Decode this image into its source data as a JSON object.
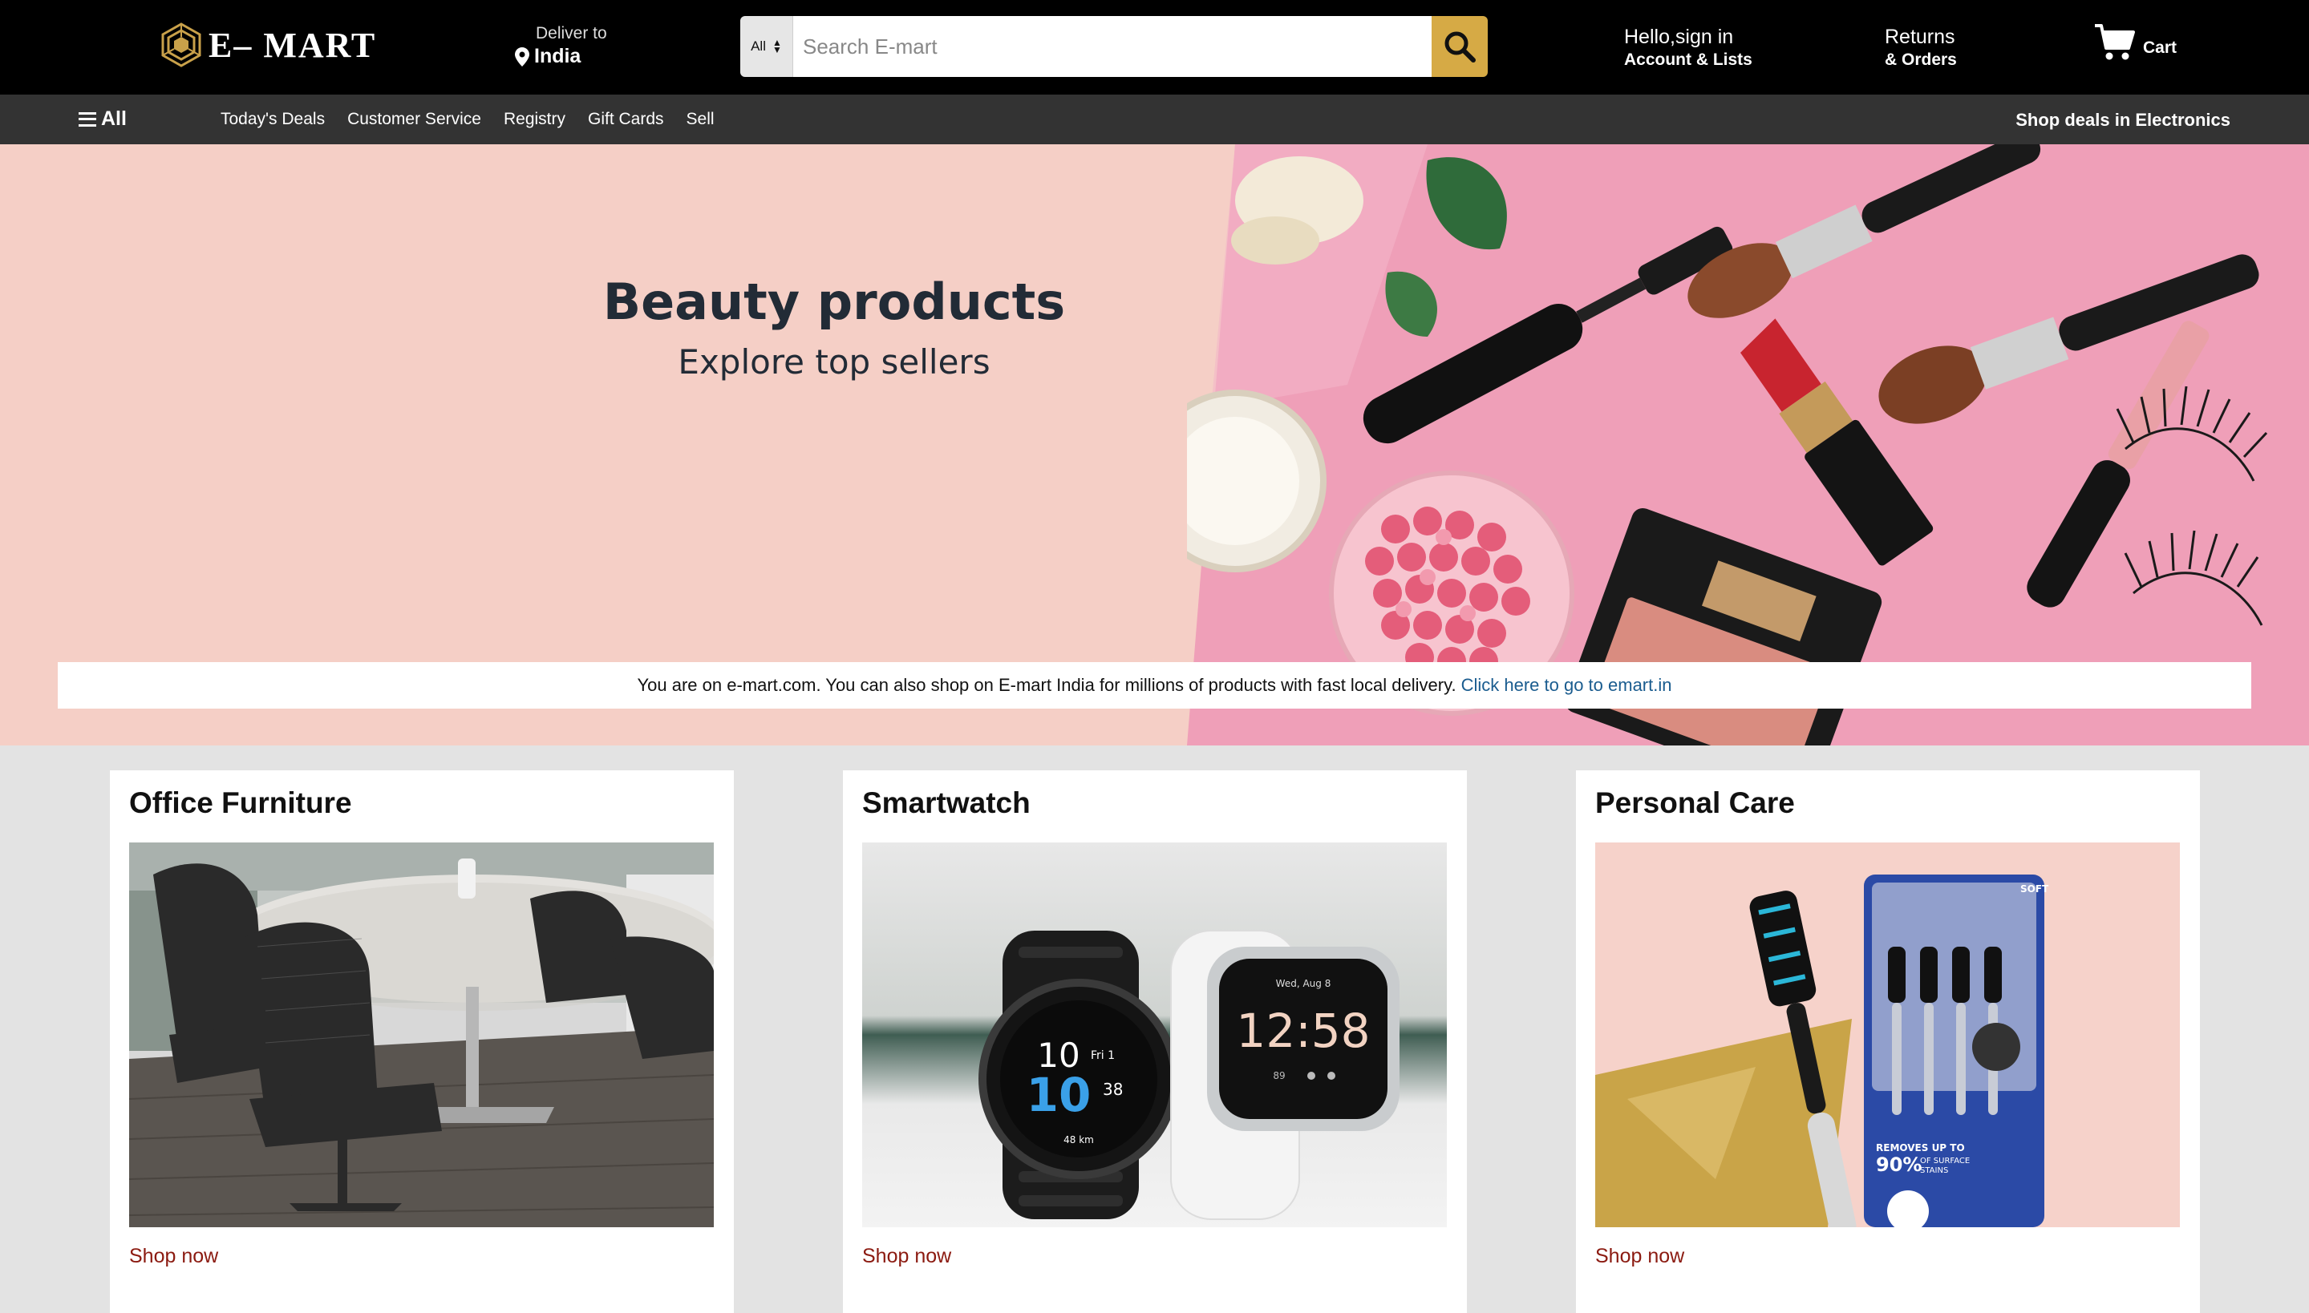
{
  "header": {
    "logo_text": "E– MART",
    "deliver_label": "Deliver to",
    "deliver_location": "India",
    "search_category": "All",
    "search_placeholder": "Search E-mart",
    "signin_line1": "Hello,sign in",
    "signin_line2": "Account & Lists",
    "returns_line1": "Returns",
    "returns_line2": "& Orders",
    "cart_label": "Cart"
  },
  "nav": {
    "all_label": "All",
    "links": [
      "Today's Deals",
      "Customer Service",
      "Registry",
      "Gift Cards",
      "Sell"
    ],
    "promo": "Shop deals in Electronics"
  },
  "hero": {
    "title": "Beauty products",
    "subtitle": "Explore top sellers",
    "notice_text": "You are on e-mart.com. You can also shop on E-mart India for millions of products with fast local delivery.",
    "notice_link": "Click here to go to emart.in"
  },
  "cards": [
    {
      "title": "Office Furniture",
      "link": "Shop now"
    },
    {
      "title": "Smartwatch",
      "link": "Shop now"
    },
    {
      "title": "Personal Care",
      "link": "Shop now"
    }
  ],
  "colors": {
    "header_bg": "#000000",
    "nav_bg": "#333333",
    "search_button": "#d6aa45",
    "hero_bg": "#f5cfc6",
    "page_bg": "#e3e3e3",
    "link_color": "#8b1a10",
    "notice_link": "#1a5c8f"
  },
  "icons": {
    "logo": "cube-logo-icon",
    "location": "map-pin-icon",
    "search": "magnifier-icon",
    "cart": "shopping-cart-icon",
    "menu": "hamburger-icon"
  }
}
